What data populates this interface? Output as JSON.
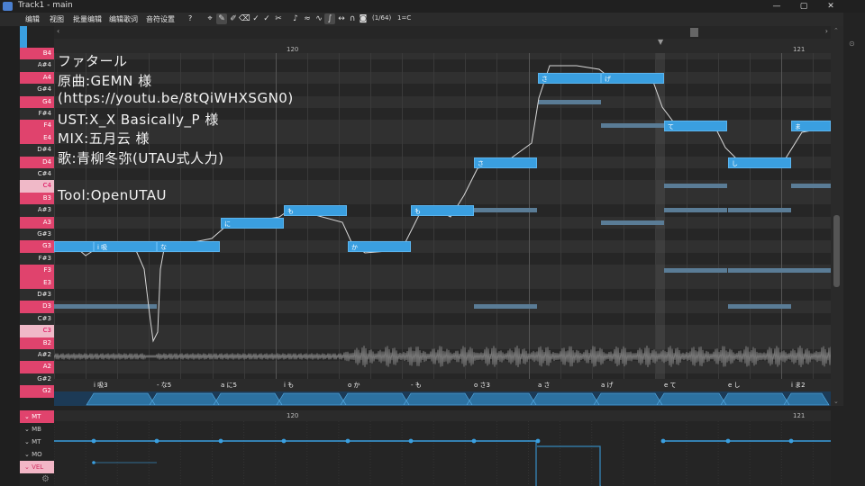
{
  "window": {
    "title": "Track1 - main",
    "controls": [
      "—",
      "▢",
      "✕"
    ]
  },
  "menu": {
    "items": [
      "编辑",
      "视图",
      "批量编辑",
      "编辑歌词",
      "音符设置",
      "?"
    ],
    "ratio": "(1/64)",
    "key": "1=C"
  },
  "ruler": {
    "markers": [
      "120",
      "121"
    ]
  },
  "keys": [
    "B4",
    "A#4",
    "A4",
    "G#4",
    "G4",
    "F#4",
    "F4",
    "E4",
    "D#4",
    "D4",
    "C#4",
    "C4",
    "B3",
    "A#3",
    "A3",
    "G#3",
    "G3",
    "F#3",
    "F3",
    "E3",
    "D#3",
    "D3",
    "C#3",
    "C3",
    "B2",
    "A#2",
    "A2",
    "G#2",
    "G2"
  ],
  "notes": [
    {
      "lyric": "",
      "pitch": "G3"
    },
    {
      "lyric": "i 吸",
      "pitch": "G3"
    },
    {
      "lyric": "な",
      "pitch": "G3"
    },
    {
      "lyric": "に",
      "pitch": "A3"
    },
    {
      "lyric": "も",
      "pitch": "A#3"
    },
    {
      "lyric": "か",
      "pitch": "G3"
    },
    {
      "lyric": "も",
      "pitch": "A#3"
    },
    {
      "lyric": "さ",
      "pitch": "D4"
    },
    {
      "lyric": "さ",
      "pitch": "A4"
    },
    {
      "lyric": "げ",
      "pitch": "A4"
    },
    {
      "lyric": "て",
      "pitch": "F4"
    },
    {
      "lyric": "し",
      "pitch": "D4"
    },
    {
      "lyric": "ま",
      "pitch": "F4"
    }
  ],
  "credits": [
    "ファタール",
    "原曲:GEMN 様",
    "(https://youtu.be/8tQiWHXSGN0)",
    "UST:X_X Basically_P 様",
    "MIX:五月云 様",
    "歌:青柳冬弥(UTAU式人力)",
    "",
    "Tool:OpenUTAU"
  ],
  "phonemes": [
    "i 吸3",
    "- な5",
    "a に5",
    "i も",
    "o か",
    "- も",
    "o さ3",
    "a さ",
    "a げ",
    "e て",
    "e し",
    "i ま2"
  ],
  "expressions": [
    "MT",
    "MB",
    "MT",
    "MO",
    "VEL"
  ]
}
